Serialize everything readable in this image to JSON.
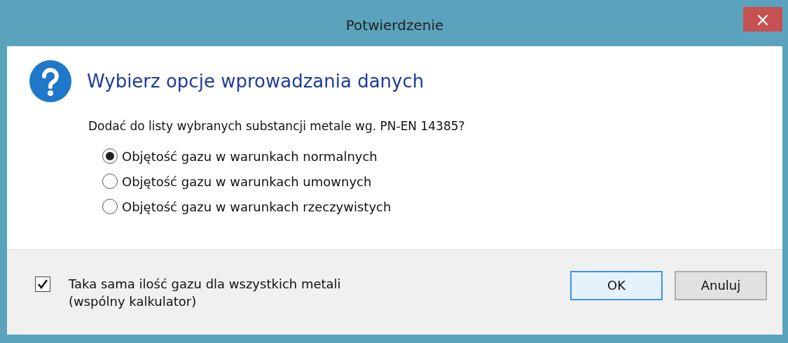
{
  "window": {
    "title": "Potwierdzenie",
    "close": "×"
  },
  "heading": "Wybierz opcje wprowadzania danych",
  "question": "Dodać do listy wybranych substancji metale wg. PN-EN 14385?",
  "options": [
    {
      "label": "Objętość gazu w warunkach normalnych",
      "selected": true
    },
    {
      "label": "Objętość gazu w warunkach umownych",
      "selected": false
    },
    {
      "label": "Objętość gazu w warunkach rzeczywistych",
      "selected": false
    }
  ],
  "checkbox": {
    "lines": [
      "Taka sama ilość gazu dla wszystkich metali",
      "(wspólny kalkulator)"
    ],
    "checked": true
  },
  "buttons": [
    {
      "label": "OK",
      "default": true
    },
    {
      "label": "Anuluj",
      "default": false
    }
  ]
}
